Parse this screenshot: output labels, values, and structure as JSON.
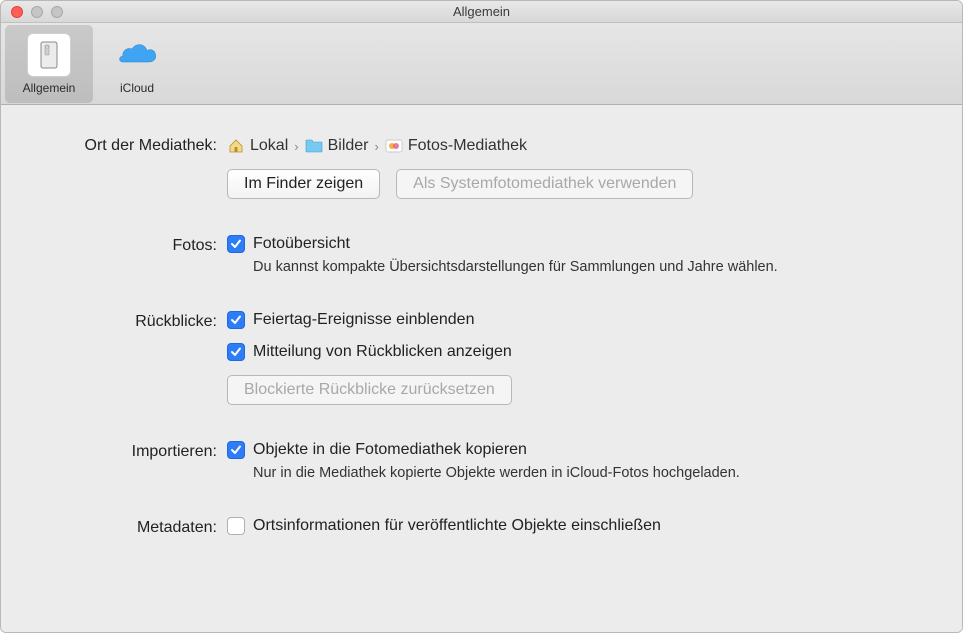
{
  "window": {
    "title": "Allgemein"
  },
  "toolbar": {
    "tabs": [
      {
        "label": "Allgemein",
        "selected": true
      },
      {
        "label": "iCloud",
        "selected": false
      }
    ]
  },
  "location": {
    "label": "Ort der Mediathek:",
    "crumbs": [
      "Lokal",
      "Bilder",
      "Fotos-Mediathek"
    ],
    "show_in_finder": "Im Finder zeigen",
    "use_as_system": "Als Systemfotomediathek verwenden"
  },
  "photos": {
    "label": "Fotos:",
    "summarize": {
      "label": "Fotoübersicht",
      "checked": true
    },
    "helper": "Du kannst kompakte Übersichtsdarstellungen für Sammlungen und Jahre wählen."
  },
  "memories": {
    "label": "Rückblicke:",
    "show_holidays": {
      "label": "Feiertag-Ereignisse einblenden",
      "checked": true
    },
    "show_notification": {
      "label": "Mitteilung von Rückblicken anzeigen",
      "checked": true
    },
    "reset_blocked": "Blockierte Rückblicke zurücksetzen"
  },
  "import": {
    "label": "Importieren:",
    "copy_items": {
      "label": "Objekte in die Fotomediathek kopieren",
      "checked": true
    },
    "helper": "Nur in die Mediathek kopierte Objekte werden in iCloud-Fotos hochgeladen."
  },
  "metadata": {
    "label": "Metadaten:",
    "include_location": {
      "label": "Ortsinformationen für veröffentlichte Objekte einschließen",
      "checked": false
    }
  }
}
